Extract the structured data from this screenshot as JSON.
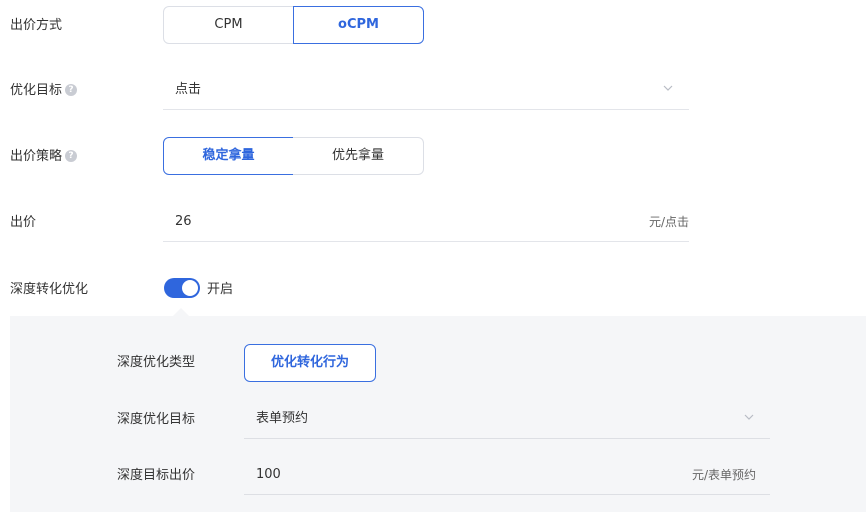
{
  "bid_method": {
    "label": "出价方式",
    "options": [
      "CPM",
      "oCPM"
    ],
    "selected": "oCPM"
  },
  "optimization_goal": {
    "label": "优化目标",
    "help_icon": "question-circle-icon",
    "value": "点击",
    "icon": "chevron-down-icon"
  },
  "bid_strategy": {
    "label": "出价策略",
    "help_icon": "question-circle-icon",
    "options": [
      "稳定拿量",
      "优先拿量"
    ],
    "selected": "稳定拿量"
  },
  "bid": {
    "label": "出价",
    "value": "26",
    "unit": "元/点击"
  },
  "deep_conversion": {
    "label": "深度转化优化",
    "enabled": true,
    "toggle_text": "开启"
  },
  "deep_panel": {
    "type_label": "深度优化类型",
    "type_option": "优化转化行为",
    "goal_label": "深度优化目标",
    "goal_value": "表单预约",
    "goal_icon": "chevron-down-icon",
    "bid_label": "深度目标出价",
    "bid_value": "100",
    "bid_unit": "元/表单预约"
  },
  "colors": {
    "accent": "#2f66dd",
    "panel_bg": "#f5f6f8",
    "border": "#dcdfe6"
  }
}
